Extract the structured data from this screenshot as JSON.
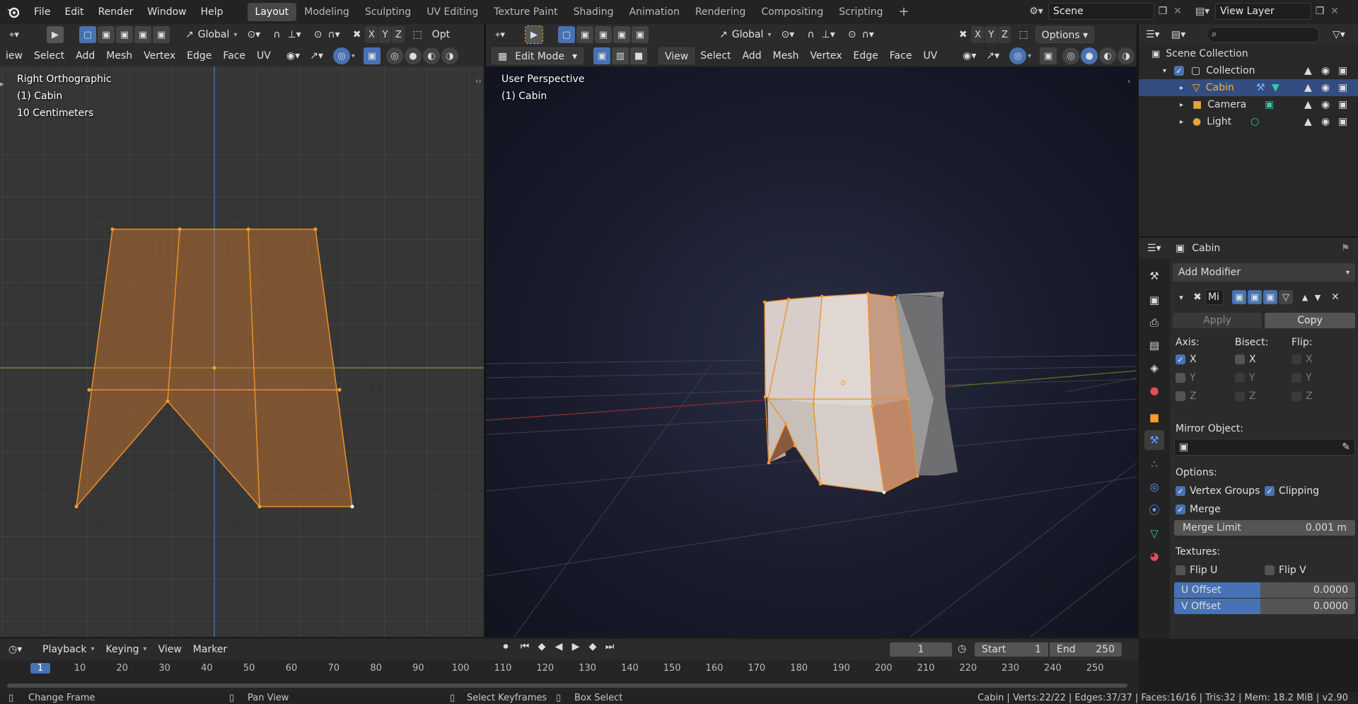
{
  "topbar": {
    "menus": [
      "File",
      "Edit",
      "Render",
      "Window",
      "Help"
    ],
    "workspaces": [
      "Layout",
      "Modeling",
      "Sculpting",
      "UV Editing",
      "Texture Paint",
      "Shading",
      "Animation",
      "Rendering",
      "Compositing",
      "Scripting"
    ],
    "active_workspace": "Layout",
    "add_tab": "+",
    "scene": "Scene",
    "view_layer": "View Layer"
  },
  "left_view": {
    "orientation": "Global",
    "axes": [
      "X",
      "Y",
      "Z"
    ],
    "options_partial": "Opt",
    "menus": [
      "iew",
      "Select",
      "Add",
      "Mesh",
      "Vertex",
      "Edge",
      "Face",
      "UV"
    ],
    "overlay_lines": [
      "Right Orthographic",
      "(1) Cabin",
      "10 Centimeters"
    ]
  },
  "right_view": {
    "orientation": "Global",
    "axes": [
      "X",
      "Y",
      "Z"
    ],
    "options": "Options",
    "mode": "Edit Mode",
    "menus": [
      "View",
      "Select",
      "Add",
      "Mesh",
      "Vertex",
      "Edge",
      "Face",
      "UV"
    ],
    "overlay_lines": [
      "User Perspective",
      "(1) Cabin"
    ]
  },
  "outliner": {
    "root": "Scene Collection",
    "collection": "Collection",
    "items": [
      {
        "name": "Cabin",
        "selected": true
      },
      {
        "name": "Camera",
        "selected": false
      },
      {
        "name": "Light",
        "selected": false
      }
    ]
  },
  "properties": {
    "object_name": "Cabin",
    "add_modifier": "Add Modifier",
    "modifier_name": "Mi",
    "apply": "Apply",
    "copy": "Copy",
    "axis_label": "Axis:",
    "bisect_label": "Bisect:",
    "flip_label": "Flip:",
    "axis": [
      {
        "label": "X",
        "on": true
      },
      {
        "label": "Y",
        "on": false
      },
      {
        "label": "Z",
        "on": false
      }
    ],
    "bisect": [
      "X",
      "Y",
      "Z"
    ],
    "flip": [
      "X",
      "Y",
      "Z"
    ],
    "mirror_object_label": "Mirror Object:",
    "options_label": "Options:",
    "vertex_groups": "Vertex Groups",
    "clipping": "Clipping",
    "merge": "Merge",
    "merge_limit_label": "Merge Limit",
    "merge_limit_value": "0.001 m",
    "textures_label": "Textures:",
    "flip_u": "Flip U",
    "flip_v": "Flip V",
    "u_offset_label": "U Offset",
    "u_offset_value": "0.0000",
    "v_offset_label": "V Offset",
    "v_offset_value": "0.0000"
  },
  "timeline": {
    "menus": [
      "Playback",
      "Keying",
      "View",
      "Marker"
    ],
    "current_frame": "1",
    "start_label": "Start",
    "start_value": "1",
    "end_label": "End",
    "end_value": "250",
    "ticks": [
      "1",
      "10",
      "20",
      "30",
      "40",
      "50",
      "60",
      "70",
      "80",
      "90",
      "100",
      "110",
      "120",
      "130",
      "140",
      "150",
      "160",
      "170",
      "180",
      "190",
      "200",
      "210",
      "220",
      "230",
      "240",
      "250"
    ]
  },
  "status": {
    "change_frame": "Change Frame",
    "pan_view": "Pan View",
    "select_keyframes": "Select Keyframes",
    "box_select": "Box Select",
    "stats": "Cabin | Verts:22/22 | Edges:37/37 | Faces:16/16 | Tris:32 | Mem: 18.2 MiB | v2.90"
  },
  "colors": {
    "accent": "#4772b3",
    "selection_orange": "#ff9d2a",
    "outliner_selected": "#334d80"
  }
}
